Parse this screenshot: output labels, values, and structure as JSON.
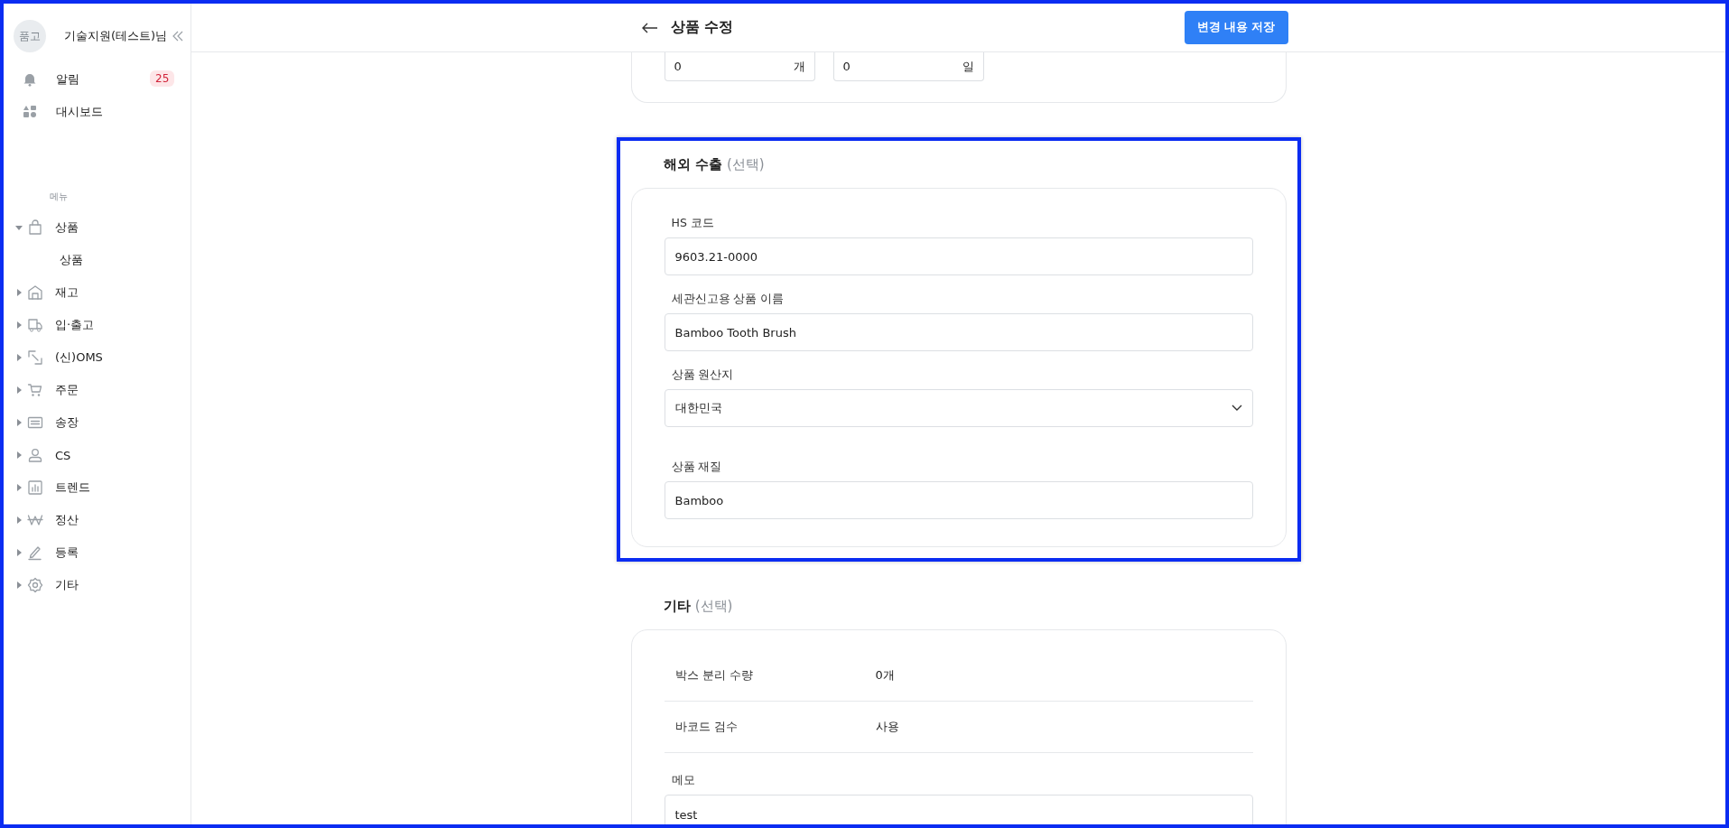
{
  "sidebar": {
    "avatar": "품고",
    "user": "기술지원(테스트)님",
    "top_items": [
      {
        "label": "알림",
        "kind": "bell",
        "badge": "25"
      },
      {
        "label": "대시보드",
        "kind": "dashboard"
      }
    ],
    "menu_heading": "메뉴",
    "menu": [
      {
        "label": "상품",
        "kind": "bag",
        "expanded": true,
        "children": [
          {
            "label": "상품"
          }
        ]
      },
      {
        "label": "재고",
        "kind": "warehouse",
        "expanded": false
      },
      {
        "label": "입·출고",
        "kind": "truck",
        "expanded": false
      },
      {
        "label": "(신)OMS",
        "kind": "link",
        "expanded": false
      },
      {
        "label": "주문",
        "kind": "cart",
        "expanded": false
      },
      {
        "label": "송장",
        "kind": "list",
        "expanded": false
      },
      {
        "label": "CS",
        "kind": "person",
        "expanded": false
      },
      {
        "label": "트렌드",
        "kind": "chart",
        "expanded": false
      },
      {
        "label": "정산",
        "kind": "won",
        "expanded": false
      },
      {
        "label": "등록",
        "kind": "pencil",
        "expanded": false
      },
      {
        "label": "기타",
        "kind": "gear",
        "expanded": false
      }
    ]
  },
  "header": {
    "title": "상품 수정",
    "save_button": "변경 내용 저장"
  },
  "top_card": {
    "fields": [
      {
        "value": "0",
        "unit": "개"
      },
      {
        "value": "0",
        "unit": "일"
      }
    ]
  },
  "export_section": {
    "title": "해외 수출",
    "optional": "(선택)",
    "highlighted": true,
    "fields": [
      {
        "kind": "text",
        "label": "HS 코드",
        "value": "9603.21-0000"
      },
      {
        "kind": "text",
        "label": "세관신고용 상품 이름",
        "value": "Bamboo Tooth Brush"
      },
      {
        "kind": "select",
        "label": "상품 원산지",
        "value": "대한민국"
      },
      {
        "kind": "text",
        "label": "상품 재질",
        "value": "Bamboo"
      }
    ]
  },
  "other_section": {
    "title": "기타",
    "optional": "(선택)",
    "highlighted": false,
    "rows": [
      {
        "label": "박스 분리 수량",
        "value": "0개"
      },
      {
        "label": "바코드 검수",
        "value": "사용"
      }
    ],
    "memo": {
      "label": "메모",
      "value": "test"
    }
  }
}
